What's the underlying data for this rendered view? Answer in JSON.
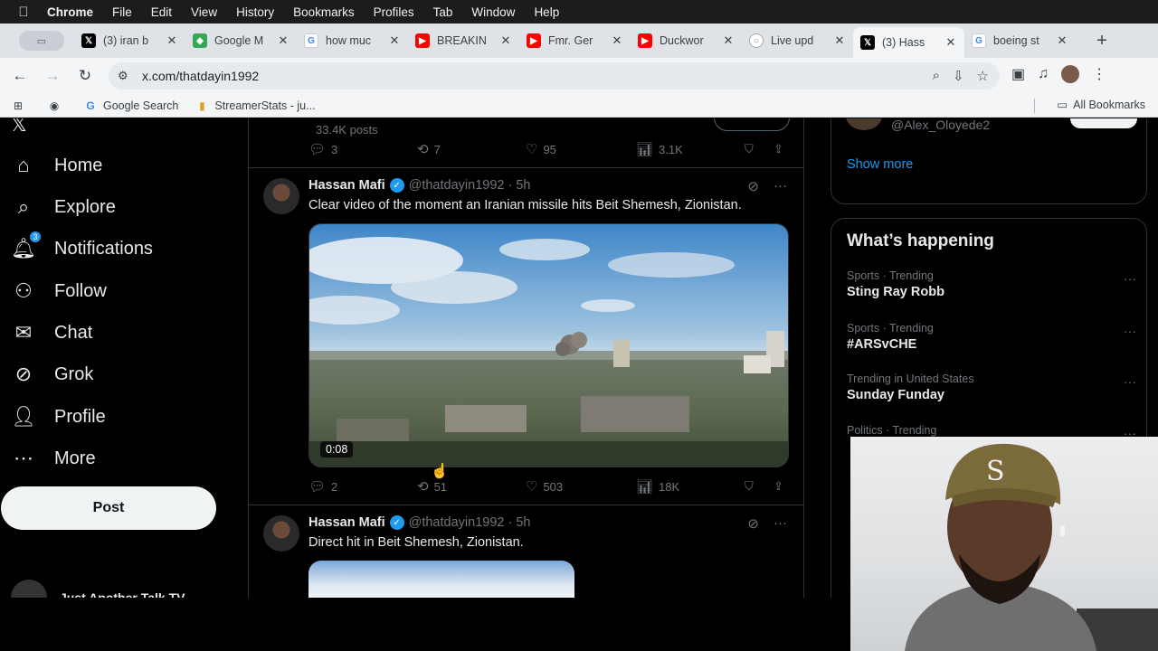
{
  "menubar": {
    "app": "Chrome",
    "items": [
      "File",
      "Edit",
      "View",
      "History",
      "Bookmarks",
      "Profiles",
      "Tab",
      "Window",
      "Help"
    ]
  },
  "tabs": [
    {
      "label": "(3) iran b",
      "icon": "x-logo-icon",
      "color": "#000000"
    },
    {
      "label": "Google M",
      "icon": "google-maps-icon",
      "color": "#34a853"
    },
    {
      "label": "how muc",
      "icon": "google-icon",
      "color": "#4285f4"
    },
    {
      "label": "BREAKIN",
      "icon": "youtube-icon",
      "color": "#ff0000"
    },
    {
      "label": "Fmr. Ger",
      "icon": "youtube-icon",
      "color": "#ff0000"
    },
    {
      "label": "Duckwor",
      "icon": "youtube-icon",
      "color": "#ff0000"
    },
    {
      "label": "Live upd",
      "icon": "globe-icon",
      "color": "#8a8f94"
    },
    {
      "label": "(3) Hass",
      "icon": "x-logo-icon",
      "color": "#000000",
      "active": true
    },
    {
      "label": "boeing st",
      "icon": "google-icon",
      "color": "#4285f4"
    }
  ],
  "url": "x.com/thatdayin1992",
  "bookmarks": {
    "items": [
      "Google Search",
      "StreamerStats - ju..."
    ],
    "all_bookmarks": "All Bookmarks"
  },
  "nav": {
    "items": [
      "Home",
      "Explore",
      "Notifications",
      "Follow",
      "Chat",
      "Grok",
      "Profile",
      "More"
    ],
    "notifications_badge": "3",
    "post_label": "Post",
    "account_name": "Just Another Talk TV"
  },
  "timeline": {
    "prev_post_count": "33.4K posts",
    "prev_actions": {
      "replies": "3",
      "reposts": "7",
      "likes": "95",
      "views": "3.1K"
    },
    "tweets": [
      {
        "name": "Hassan Mafi",
        "handle_time": "@thatdayin1992 · 5h",
        "text": "Clear video of the moment an Iranian missile hits Beit Shemesh, Zionistan.",
        "video_duration": "0:08",
        "actions": {
          "replies": "2",
          "reposts": "51",
          "likes": "503",
          "views": "18K"
        }
      },
      {
        "name": "Hassan Mafi",
        "handle_time": "@thatdayin1992 · 5h",
        "text": "Direct hit in Beit Shemesh, Zionistan."
      }
    ]
  },
  "right": {
    "suggested_handle": "@Alex_Oloyede2",
    "show_more": "Show more",
    "whats_happening": "What’s happening",
    "trends": [
      {
        "category": "Sports · Trending",
        "name": "Sting Ray Robb"
      },
      {
        "category": "Sports · Trending",
        "name": "#ARSvCHE"
      },
      {
        "category": "Trending in United States",
        "name": "Sunday Funday"
      },
      {
        "category": "Politics · Trending",
        "name": ""
      }
    ]
  },
  "colors": {
    "accent": "#1d9bf0",
    "background": "#000000",
    "muted": "#71767b"
  }
}
